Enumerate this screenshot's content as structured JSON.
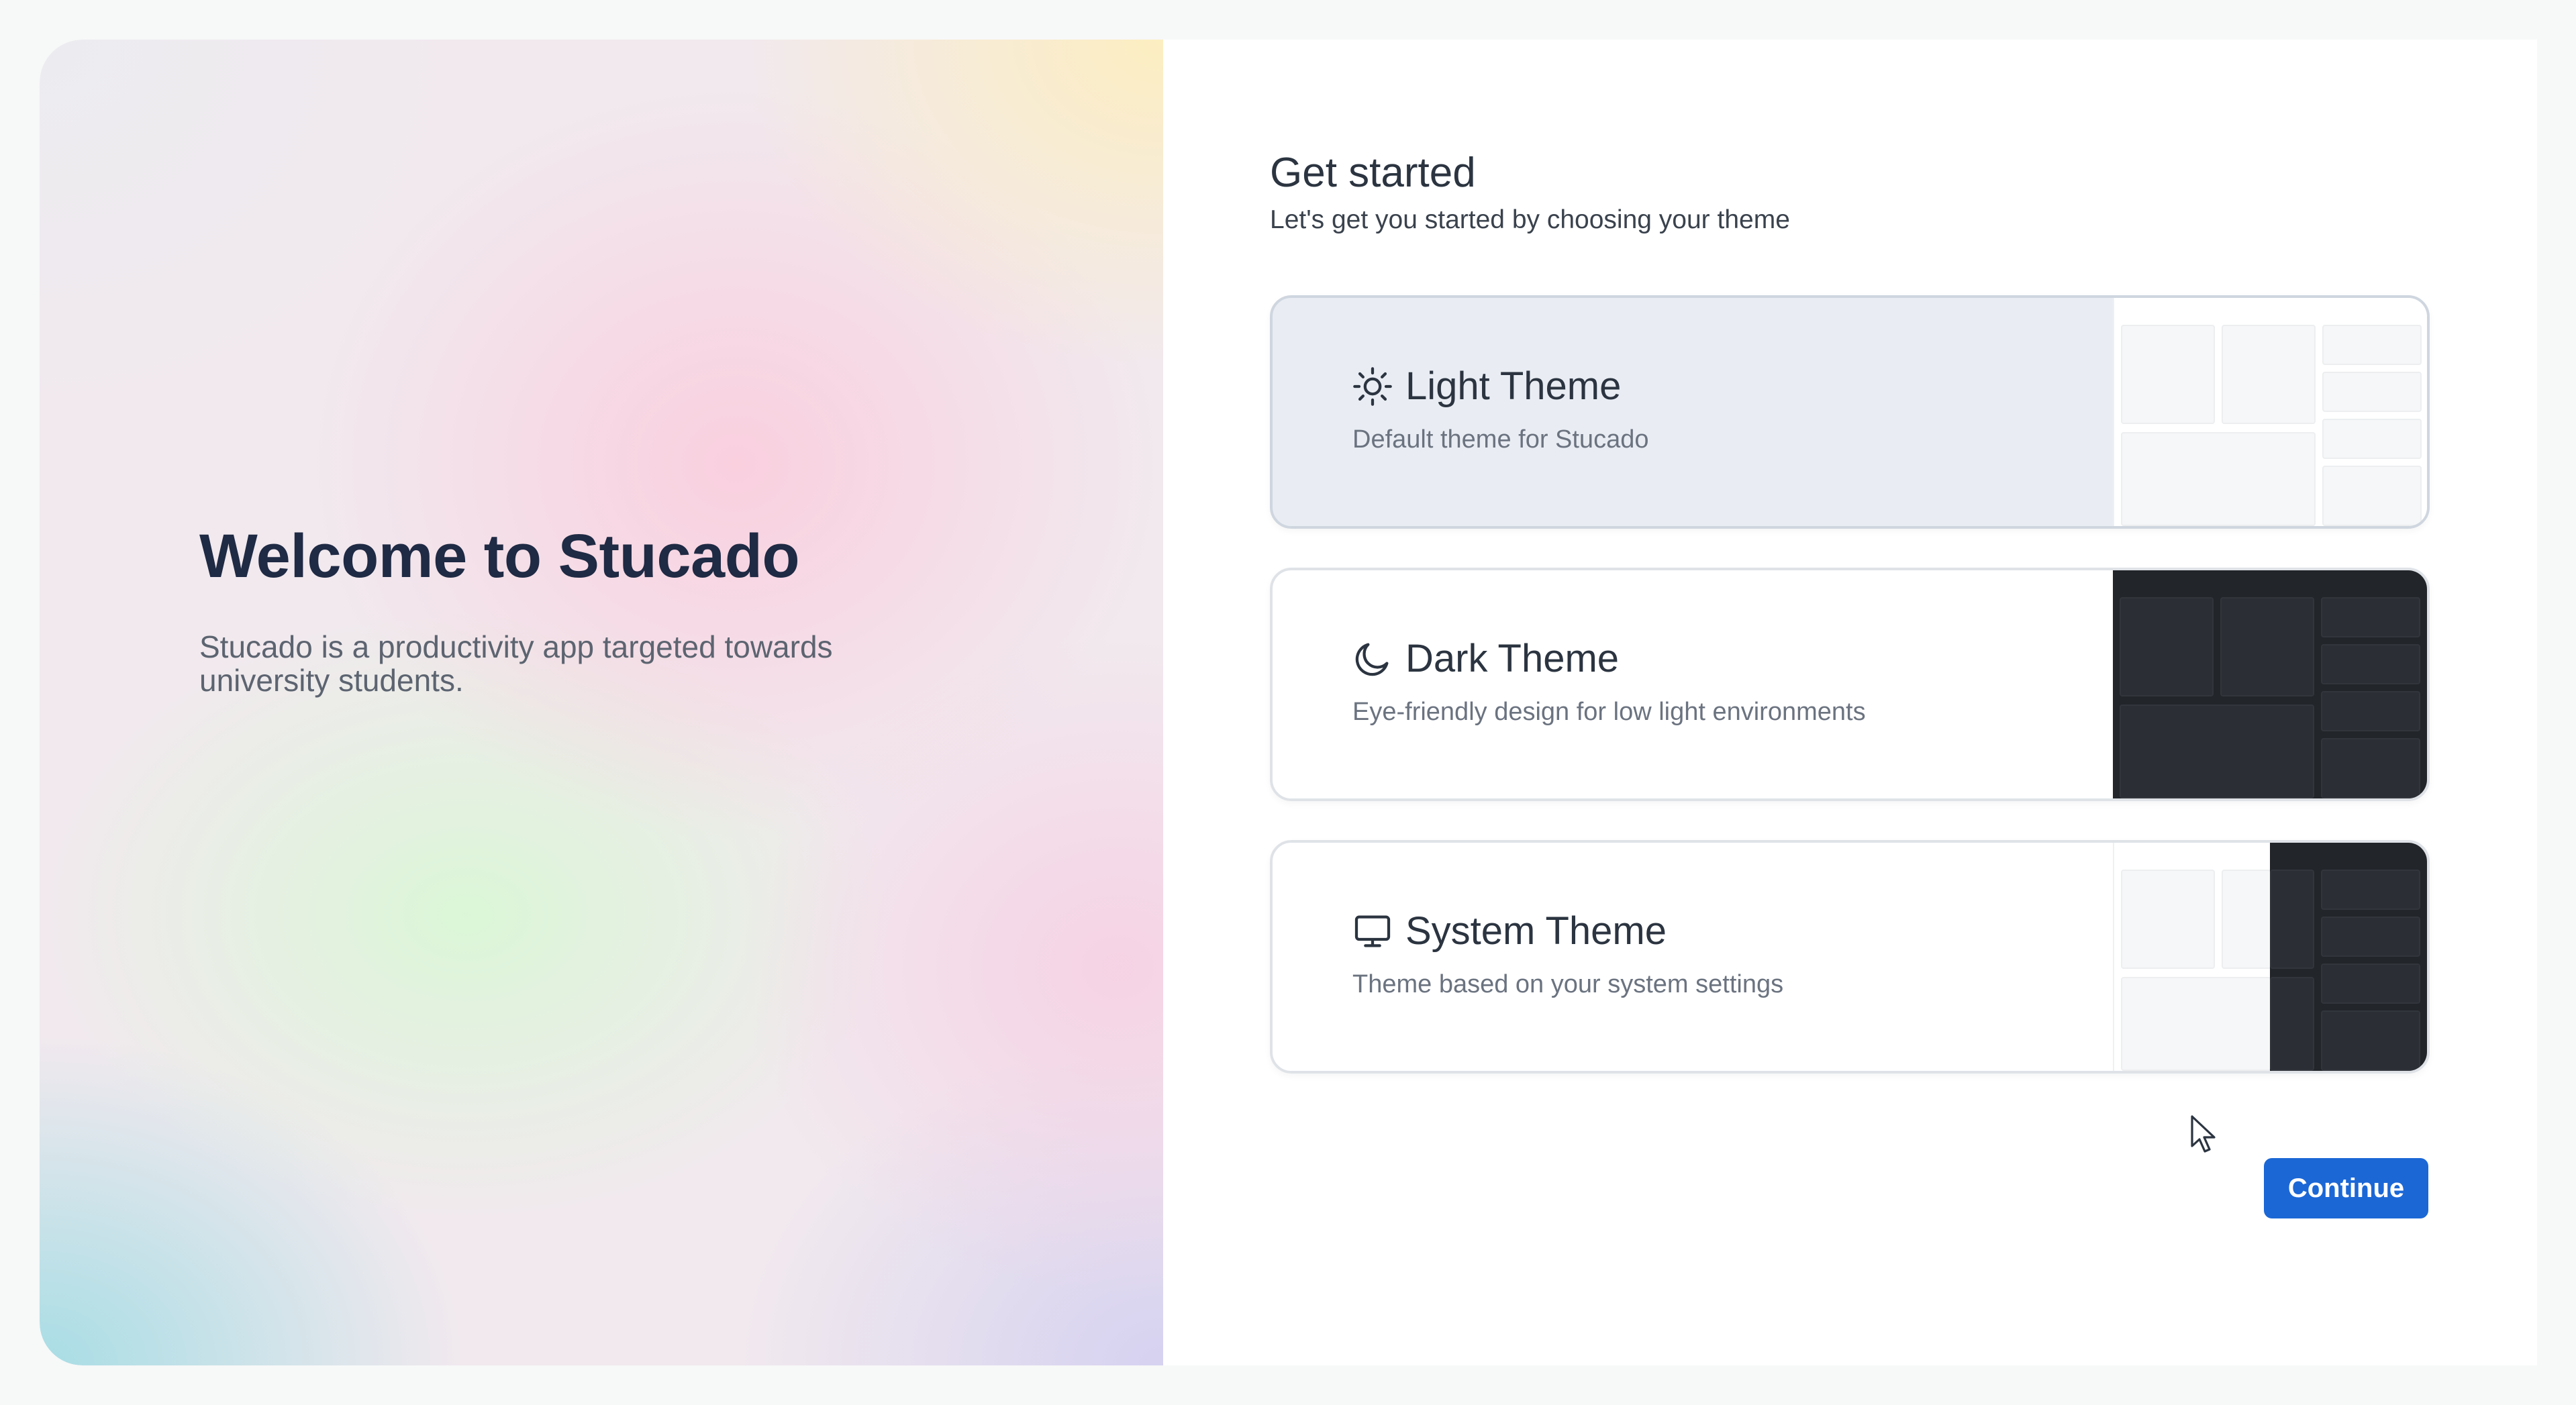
{
  "hero": {
    "title": "Welcome to Stucado",
    "subtitle": "Stucado is a productivity app targeted towards university students."
  },
  "setup": {
    "heading": "Get started",
    "subheading": "Let's get you started by choosing your theme",
    "themes": [
      {
        "title": "Light Theme",
        "description": "Default theme for Stucado",
        "icon": "sun-icon",
        "selected": true,
        "preview": "light"
      },
      {
        "title": "Dark Theme",
        "description": "Eye-friendly design for low light environments",
        "icon": "moon-icon",
        "selected": false,
        "preview": "dark"
      },
      {
        "title": "System Theme",
        "description": "Theme based on your system settings",
        "icon": "monitor-icon",
        "selected": false,
        "preview": "split"
      }
    ],
    "continue_label": "Continue"
  },
  "colors": {
    "accent": "#1b67d6",
    "heading_text": "#1f2a44",
    "selected_card": "#e9edf3",
    "dark_preview": "#22252a"
  }
}
